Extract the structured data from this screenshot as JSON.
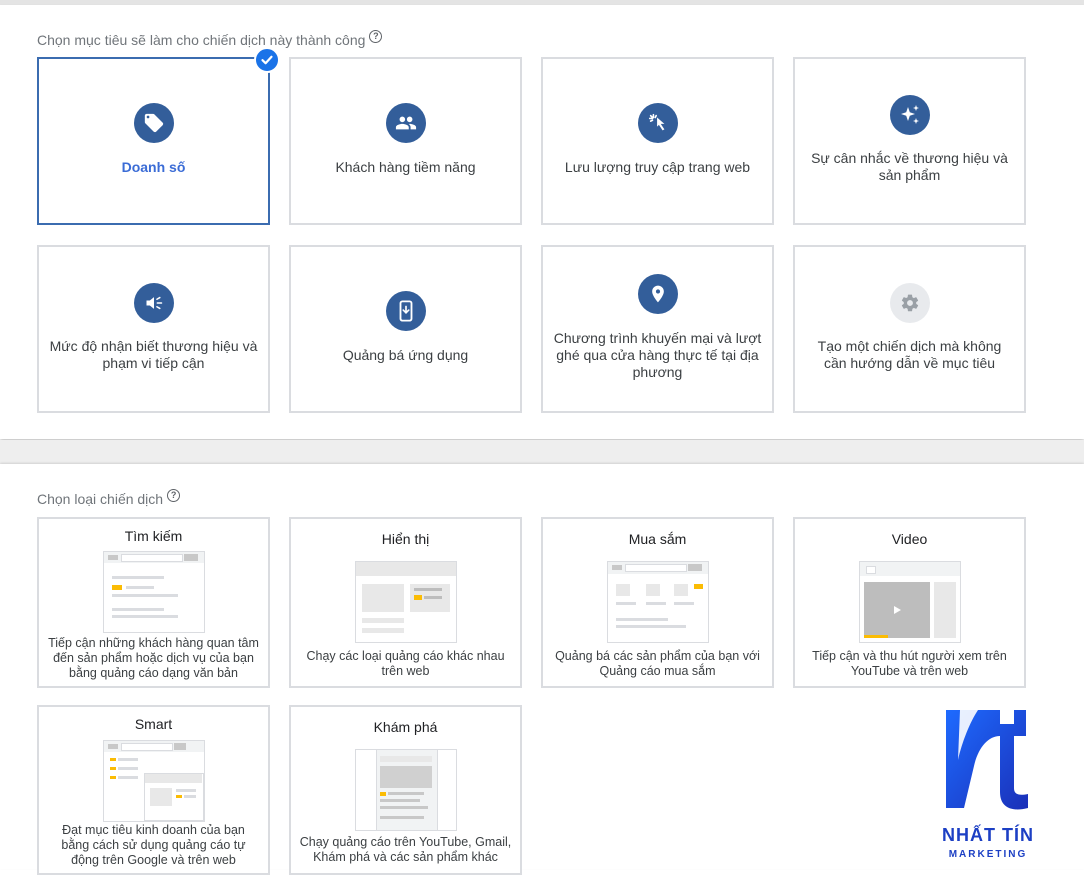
{
  "goal_section": {
    "title": "Chọn mục tiêu sẽ làm cho chiến dịch này thành công",
    "help": "?",
    "goals": [
      {
        "label": "Doanh số",
        "icon": "tag-icon",
        "selected": true
      },
      {
        "label": "Khách hàng tiềm năng",
        "icon": "people-icon"
      },
      {
        "label": "Lưu lượng truy cập trang web",
        "icon": "cursor-click-icon"
      },
      {
        "label": "Sự cân nhắc về thương hiệu và sản phẩm",
        "icon": "sparkle-icon"
      },
      {
        "label": "Mức độ nhận biết thương hiệu và phạm vi tiếp cận",
        "icon": "megaphone-icon"
      },
      {
        "label": "Quảng bá ứng dụng",
        "icon": "phone-download-icon"
      },
      {
        "label": "Chương trình khuyến mại và lượt ghé qua cửa hàng thực tế tại địa phương",
        "icon": "location-pin-icon"
      },
      {
        "label": "Tạo một chiến dịch mà không cần hướng dẫn về mục tiêu",
        "icon": "gear-icon"
      }
    ]
  },
  "type_section": {
    "title": "Chọn loại chiến dịch",
    "help": "?",
    "types": [
      {
        "title": "Tìm kiếm",
        "desc": "Tiếp cận những khách hàng quan tâm đến sản phẩm hoặc dịch vụ của bạn bằng quảng cáo dạng văn bản"
      },
      {
        "title": "Hiển thị",
        "desc": "Chạy các loại quảng cáo khác nhau trên web"
      },
      {
        "title": "Mua sắm",
        "desc": "Quảng bá các sản phẩm của bạn với Quảng cáo mua sắm"
      },
      {
        "title": "Video",
        "desc": "Tiếp cận và thu hút người xem trên YouTube và trên web"
      },
      {
        "title": "Smart",
        "desc": "Đạt mục tiêu kinh doanh của bạn bằng cách sử dụng quảng cáo tự động trên Google và trên web"
      },
      {
        "title": "Khám phá",
        "desc": "Chạy quảng cáo trên YouTube, Gmail, Khám phá và các sản phẩm khác"
      }
    ]
  },
  "watermark": {
    "name": "NHẤT TÍN",
    "sub": "MARKETING"
  },
  "colors": {
    "accent": "#3b6cb0",
    "icon_bg": "#335e9a",
    "selected_text": "#3b6cd6",
    "check": "#1a73e8",
    "logo": "#1c3fc4"
  }
}
